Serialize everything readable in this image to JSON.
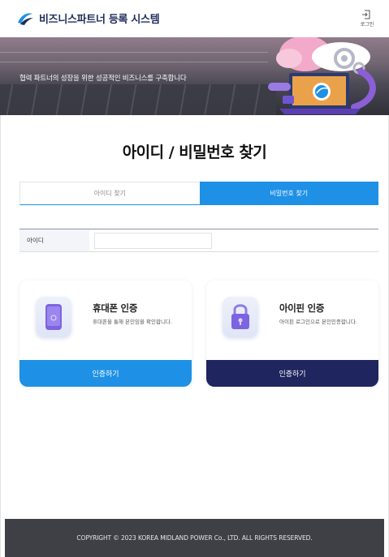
{
  "header": {
    "app_title": "비즈니스파트너 등록 시스템",
    "login_label": "로그인"
  },
  "banner": {
    "text": "협력 파트너의 성장을 위한 성공적인 비즈니스를 구축합니다"
  },
  "page": {
    "title": "아이디 / 비밀번호 찾기"
  },
  "tabs": [
    {
      "label": "아이디 찾기",
      "active": false
    },
    {
      "label": "비밀번호 찾기",
      "active": true
    }
  ],
  "form": {
    "id_label": "아이디",
    "id_value": "",
    "id_placeholder": ""
  },
  "cards": [
    {
      "title": "휴대폰 인증",
      "desc": "휴대폰을 통해 본인임을 확인합니다.",
      "button": "인증하기",
      "icon": "phone-icon"
    },
    {
      "title": "아이핀 인증",
      "desc": "아이핀 로그인으로 본인인증합니다.",
      "button": "인증하기",
      "icon": "lock-icon"
    }
  ],
  "footer": {
    "copyright": "COPYRIGHT © 2023 KOREA MIDLAND POWER Co., LTD. ALL RIGHTS RESERVED."
  },
  "colors": {
    "primary": "#1e90e6",
    "navy": "#1f255e",
    "footer_bg": "#3f4046"
  }
}
